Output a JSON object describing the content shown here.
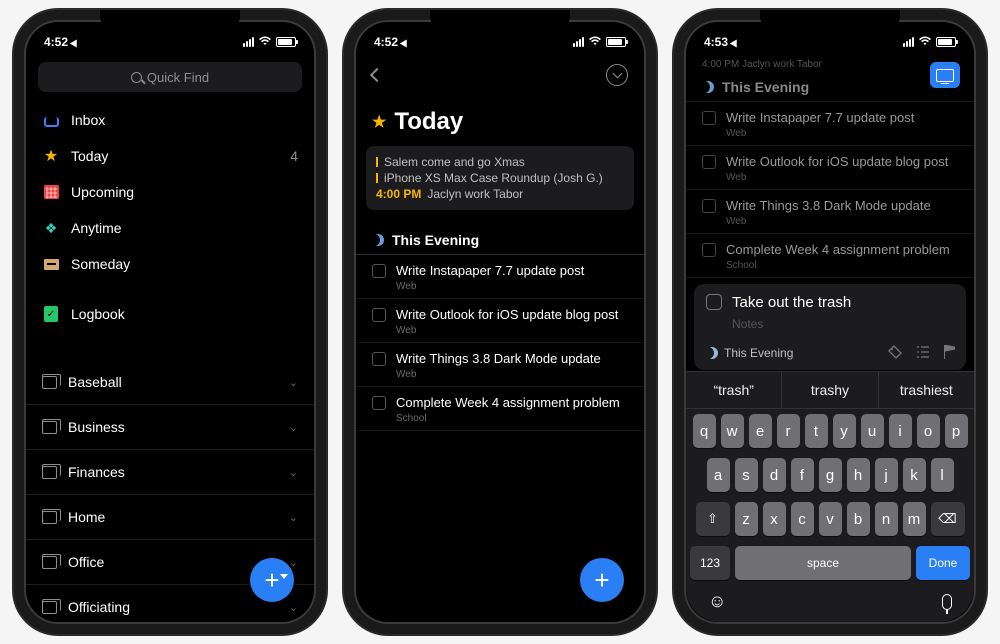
{
  "status": {
    "time1": "4:52",
    "time2": "4:52",
    "time3": "4:53"
  },
  "phone1": {
    "search_placeholder": "Quick Find",
    "smart": [
      {
        "label": "Inbox",
        "iconClass": "icon-inbox",
        "count": ""
      },
      {
        "label": "Today",
        "iconClass": "icon-star",
        "glyph": "★",
        "count": "4"
      },
      {
        "label": "Upcoming",
        "iconClass": "icon-upcoming",
        "count": ""
      },
      {
        "label": "Anytime",
        "iconClass": "icon-anytime",
        "glyph": "❖",
        "count": ""
      },
      {
        "label": "Someday",
        "iconClass": "icon-someday",
        "count": ""
      }
    ],
    "logbook": {
      "label": "Logbook",
      "glyph": "✓"
    },
    "areas": [
      "Baseball",
      "Business",
      "Finances",
      "Home",
      "Office",
      "Officiating"
    ]
  },
  "phone2": {
    "title": "Today",
    "card": {
      "line1": "Salem come and go Xmas",
      "line2": "iPhone XS Max Case Roundup (Josh G.)",
      "time": "4:00 PM",
      "line3": "Jaclyn work Tabor"
    },
    "section": "This Evening",
    "tasks": [
      {
        "title": "Write Instapaper 7.7 update post",
        "proj": "Web"
      },
      {
        "title": "Write Outlook for iOS update blog post",
        "proj": "Web"
      },
      {
        "title": "Write Things 3.8 Dark Mode update",
        "proj": "Web"
      },
      {
        "title": "Complete Week 4 assignment problem",
        "proj": "School"
      }
    ]
  },
  "phone3": {
    "banner": "4:00 PM Jaclyn work Tabor",
    "section": "This Evening",
    "tasks": [
      {
        "title": "Write Instapaper 7.7 update post",
        "proj": "Web"
      },
      {
        "title": "Write Outlook for iOS update blog post",
        "proj": "Web"
      },
      {
        "title": "Write Things 3.8 Dark Mode update",
        "proj": "Web"
      },
      {
        "title": "Complete Week 4 assignment problem",
        "proj": "School"
      }
    ],
    "new_task": {
      "title": "Take out the trash",
      "notes": "Notes",
      "list": "This Evening"
    },
    "keyboard": {
      "suggestions": [
        "“trash”",
        "trashy",
        "trashiest"
      ],
      "r1": [
        "q",
        "w",
        "e",
        "r",
        "t",
        "y",
        "u",
        "i",
        "o",
        "p"
      ],
      "r2": [
        "a",
        "s",
        "d",
        "f",
        "g",
        "h",
        "j",
        "k",
        "l"
      ],
      "r3": [
        "z",
        "x",
        "c",
        "v",
        "b",
        "n",
        "m"
      ],
      "num": "123",
      "space": "space",
      "done": "Done"
    }
  }
}
